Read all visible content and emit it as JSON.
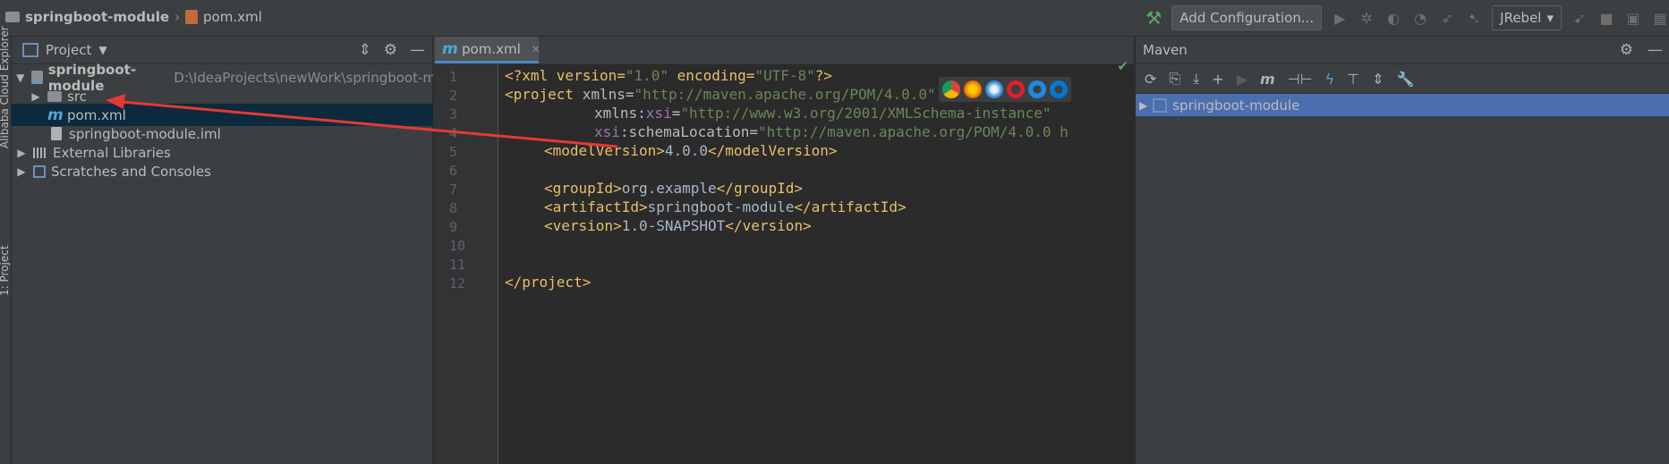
{
  "breadcrumb": {
    "project": "springboot-module",
    "file": "pom.xml"
  },
  "toolbar": {
    "add_configuration": "Add Configuration...",
    "jrebel": "JRebel"
  },
  "left_strip": {
    "cloud_explorer": "Alibaba Cloud Explorer",
    "project_tab": "1: Project"
  },
  "project_panel": {
    "title": "Project",
    "tree": [
      {
        "label": "springboot-module",
        "path": "D:\\IdeaProjects\\newWork\\springboot-m"
      },
      {
        "label": "src"
      },
      {
        "label": "pom.xml"
      },
      {
        "label": "springboot-module.iml"
      },
      {
        "label": "External Libraries"
      },
      {
        "label": "Scratches and Consoles"
      }
    ]
  },
  "editor": {
    "tab": "pom.xml",
    "line_numbers": [
      "1",
      "2",
      "3",
      "4",
      "5",
      "6",
      "7",
      "8",
      "9",
      "10",
      "11",
      "12"
    ],
    "code": {
      "l1_a": "<?xml version=",
      "l1_b": "\"1.0\"",
      "l1_c": " encoding=",
      "l1_d": "\"UTF-8\"",
      "l1_e": "?>",
      "l2_a": "<project ",
      "l2_b": "xmlns=",
      "l2_c": "\"http://maven.apache.org/POM/4.0.0\"",
      "l3_a": "xmlns:",
      "l3_b": "xsi",
      "l3_c": "=",
      "l3_d": "\"http://www.w3.org/2001/XMLSchema-instance\"",
      "l4_a": "xsi",
      "l4_b": ":schemaLocation=",
      "l4_c": "\"http://maven.apache.org/POM/4.0.0 h",
      "l5_a": "<modelVersion>",
      "l5_b": "4.0.0",
      "l5_c": "</modelVersion>",
      "l7_a": "<groupId>",
      "l7_b": "org.example",
      "l7_c": "</groupId>",
      "l8_a": "<artifactId>",
      "l8_b": "springboot-module",
      "l8_c": "</artifactId>",
      "l9_a": "<version>",
      "l9_b": "1.0-SNAPSHOT",
      "l9_c": "</version>",
      "l12": "</project>"
    }
  },
  "maven": {
    "title": "Maven",
    "project": "springboot-module"
  },
  "colors": {
    "accent": "#4b6eaf",
    "arrow": "#e53935"
  }
}
